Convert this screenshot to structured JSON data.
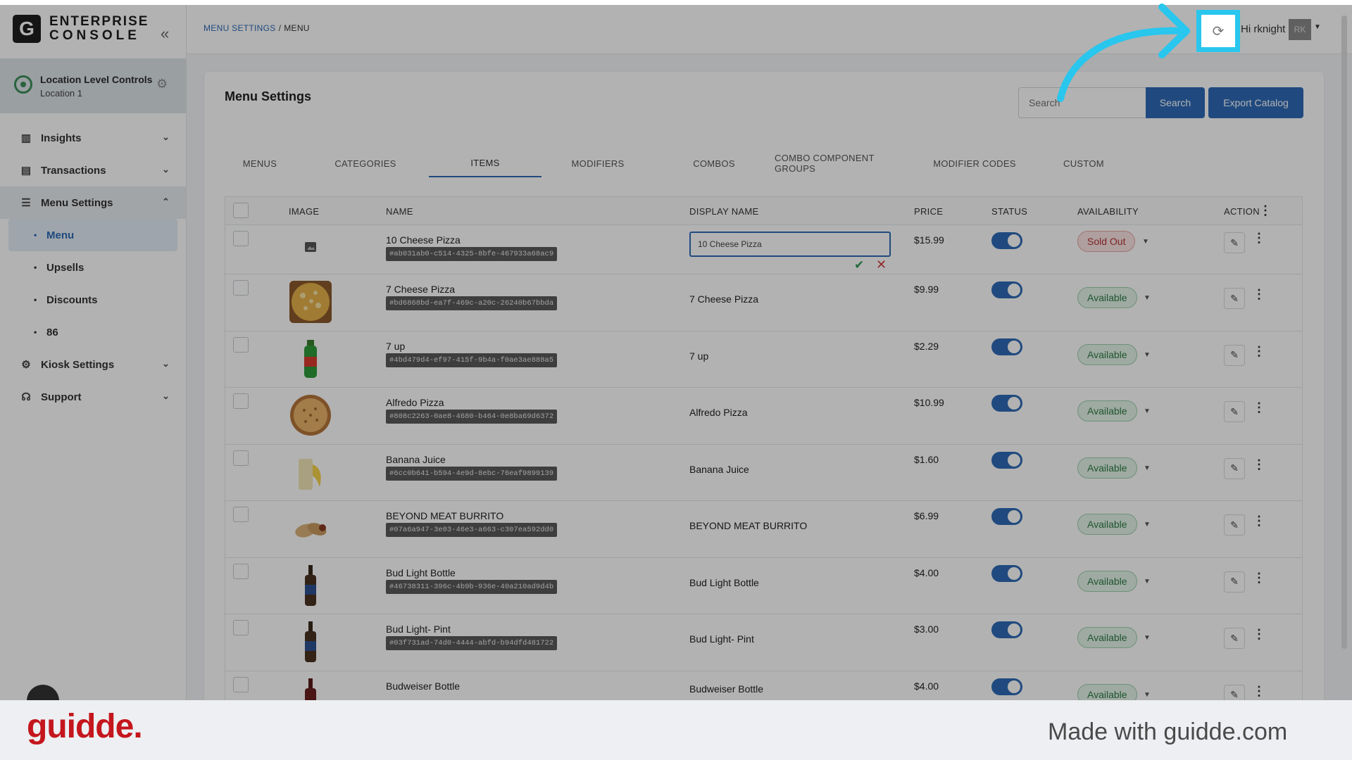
{
  "brand": {
    "logo_letter": "G",
    "line1": "ENTERPRISE",
    "line2": "CONSOLE"
  },
  "location": {
    "title": "Location Level Controls",
    "subtitle": "Location 1"
  },
  "sidebar": {
    "items": [
      {
        "label": "Insights",
        "icon": "insights-icon"
      },
      {
        "label": "Transactions",
        "icon": "transactions-icon"
      },
      {
        "label": "Menu Settings",
        "icon": "menu-settings-icon",
        "expanded": true,
        "children": [
          "Menu",
          "Upsells",
          "Discounts",
          "86"
        ]
      },
      {
        "label": "Kiosk Settings",
        "icon": "kiosk-gear-icon"
      },
      {
        "label": "Support",
        "icon": "headset-icon"
      }
    ],
    "active_child": "Menu"
  },
  "header": {
    "breadcrumb": {
      "parent": "MENU SETTINGS",
      "sep": "/",
      "current": "MENU"
    },
    "greeting": "Hi rknight",
    "avatar_initials": "RK"
  },
  "page": {
    "title": "Menu Settings",
    "search_placeholder": "Search",
    "search_button": "Search",
    "export_button": "Export Catalog",
    "tabs": [
      "MENUS",
      "CATEGORIES",
      "ITEMS",
      "MODIFIERS",
      "COMBOS",
      "COMBO COMPONENT GROUPS",
      "MODIFIER CODES",
      "CUSTOM"
    ],
    "active_tab": "ITEMS"
  },
  "table": {
    "headers": {
      "image": "IMAGE",
      "name": "NAME",
      "display_name": "DISPLAY NAME",
      "price": "PRICE",
      "status": "STATUS",
      "availability": "AVAILABILITY",
      "action": "ACTION"
    },
    "rows": [
      {
        "name": "10 Cheese Pizza",
        "id": "#ab031ab0-c514-4325-8bfe-467933a68ac9",
        "display_name": "10 Cheese Pizza",
        "editing": true,
        "price": "$15.99",
        "availability": "Sold Out",
        "thumb": "placeholder"
      },
      {
        "name": "7 Cheese Pizza",
        "id": "#bd6868bd-ea7f-469c-a20c-26240b67bbda",
        "display_name": "7 Cheese Pizza",
        "price": "$9.99",
        "availability": "Available",
        "thumb": "pizza-square"
      },
      {
        "name": "7 up",
        "id": "#4bd479d4-ef97-415f-9b4a-f0ae3ae888a5",
        "display_name": "7 up",
        "price": "$2.29",
        "availability": "Available",
        "thumb": "soda-bottle"
      },
      {
        "name": "Alfredo Pizza",
        "id": "#808c2263-0ae8-4680-b464-0e8ba69d6372",
        "display_name": "Alfredo Pizza",
        "price": "$10.99",
        "availability": "Available",
        "thumb": "pizza-round"
      },
      {
        "name": "Banana Juice",
        "id": "#6cc0b641-b594-4e9d-8ebc-76eaf9899139",
        "display_name": "Banana Juice",
        "price": "$1.60",
        "availability": "Available",
        "thumb": "juice"
      },
      {
        "name": "BEYOND MEAT BURRITO",
        "id": "#07a6a947-3e03-46e3-a663-c307ea592dd0",
        "display_name": "BEYOND MEAT BURRITO",
        "price": "$6.99",
        "availability": "Available",
        "thumb": "burrito"
      },
      {
        "name": "Bud Light Bottle",
        "id": "#46738311-396c-4b9b-936e-40a210ad9d4b",
        "display_name": "Bud Light Bottle",
        "price": "$4.00",
        "availability": "Available",
        "thumb": "beer-bottle"
      },
      {
        "name": "Bud Light- Pint",
        "id": "#03f731ad-74d0-4444-abfd-b94dfd481722",
        "display_name": "Bud Light- Pint",
        "price": "$3.00",
        "availability": "Available",
        "thumb": "beer-bottle"
      },
      {
        "name": "Budweiser Bottle",
        "id": "",
        "display_name": "Budweiser Bottle",
        "price": "$4.00",
        "availability": "Available",
        "thumb": "beer-bottle-red"
      }
    ]
  },
  "footer": {
    "logo": "guidde.",
    "made_with": "Made with guidde.com"
  },
  "colors": {
    "primary": "#2e6bb6",
    "highlight": "#29c6ee",
    "available": "#2e7a45",
    "sold_out": "#b43434",
    "brand_red": "#c4161c"
  }
}
